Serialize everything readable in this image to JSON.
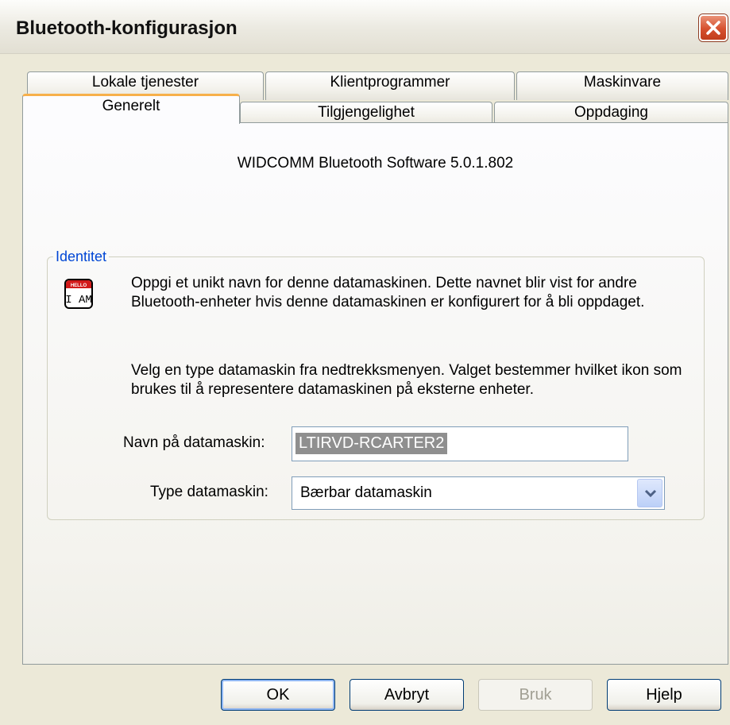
{
  "window": {
    "title": "Bluetooth-konfigurasjon",
    "close_icon": "close-icon"
  },
  "tabs": {
    "back_row": [
      "Lokale tjenester",
      "Klientprogrammer",
      "Maskinvare"
    ],
    "front_row": [
      "Generelt",
      "Tilgjengelighet",
      "Oppdaging"
    ],
    "selected": "Generelt"
  },
  "general": {
    "version": "WIDCOMM Bluetooth Software 5.0.1.802",
    "group_label": "Identitet",
    "icon_hello": "HELLO",
    "icon_iam": "I AM",
    "description_1": "Oppgi et unikt navn for denne datamaskinen. Dette navnet blir vist for andre Bluetooth-enheter hvis denne datamaskinen er konfigurert for å bli oppdaget.",
    "description_2": "Velg en type datamaskin fra nedtrekksmenyen. Valget bestemmer hvilket ikon som brukes til å representere datamaskinen på eksterne enheter.",
    "name_label": "Navn på datamaskin:",
    "name_value": "LTIRVD-RCARTER2",
    "type_label": "Type datamaskin:",
    "type_value": "Bærbar datamaskin"
  },
  "buttons": {
    "ok": "OK",
    "cancel": "Avbryt",
    "apply": "Bruk",
    "help": "Hjelp"
  },
  "colors": {
    "selected_tab_accent": "#f7b04a",
    "group_label": "#0046d5",
    "close_button": "#d6502e",
    "selection": "#8f8f8f"
  }
}
